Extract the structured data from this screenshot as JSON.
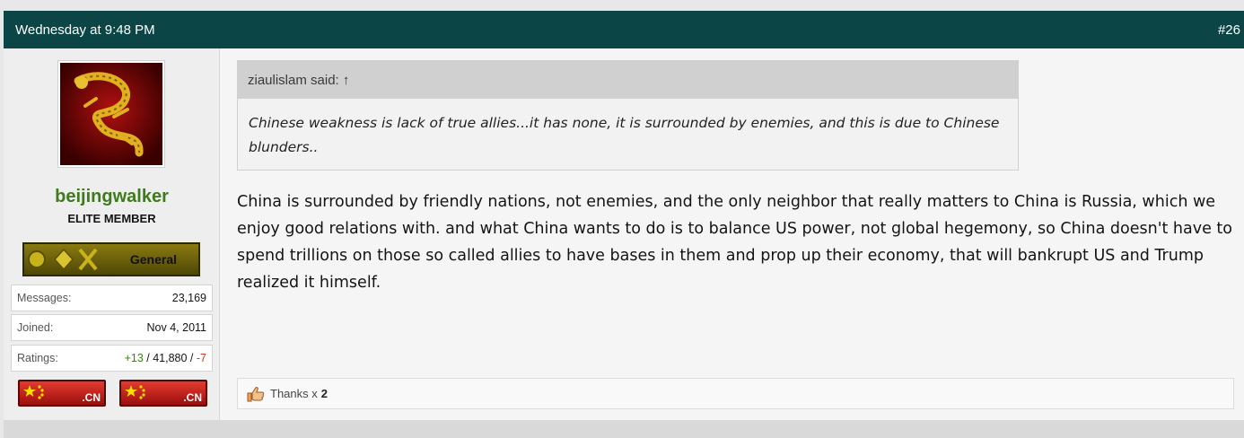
{
  "post": {
    "timestamp": "Wednesday at 9:48 PM",
    "number": "#26"
  },
  "author": {
    "username": "beijingwalker",
    "title": "ELITE MEMBER",
    "rank_label": "General",
    "stats": [
      {
        "label": "Messages:",
        "value": "23,169"
      },
      {
        "label": "Joined:",
        "value": "Nov 4, 2011"
      }
    ],
    "ratings": {
      "label": "Ratings:",
      "positive": "+13",
      "sep1": " / ",
      "neutral": "41,880",
      "sep2": " / ",
      "negative": "-7"
    },
    "flags": [
      {
        "tld": ".CN"
      },
      {
        "tld": ".CN"
      }
    ]
  },
  "quote": {
    "header": "ziaulislam said: ↑",
    "text": "Chinese weakness is lack of true allies...it has none, it is surrounded by enemies, and this is due to Chinese blunders.."
  },
  "message": "China is surrounded by friendly nations, not enemies, and the only neighbor that really matters to China is Russia, which we enjoy good relations with. and what China wants to do is to balance US power, not global hegemony, so China doesn't have to spend trillions on those so called allies to have bases in them and prop up their economy, that will bankrupt US and Trump realized it himself.",
  "reactions": {
    "icon": "thumbs-up-icon",
    "label": "Thanks x",
    "count": "2"
  },
  "colors": {
    "header_bg": "#0b4545",
    "username": "#3f7a1c",
    "negative": "#c0392b"
  }
}
